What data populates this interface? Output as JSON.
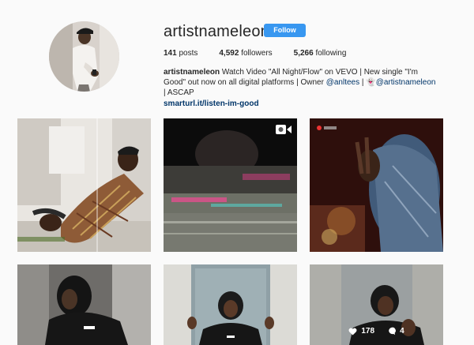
{
  "profile": {
    "username": "artistnameleon",
    "follow_label": "Follow",
    "posts_count": "141",
    "posts_label": "posts",
    "followers_count": "4,592",
    "followers_label": "followers",
    "following_count": "5,266",
    "following_label": "following"
  },
  "bio": {
    "name": "artistnameleon",
    "text_1": "Watch Video \"All Night/Flow\" on VEVO | New single \"I'm Good\" out now on all digital platforms | Owner ",
    "mention_1": "@anltees",
    "text_2": " | ",
    "emoji": "👻",
    "mention_2": "@artistnameleon",
    "text_3": " | ASCAP",
    "link": "smarturl.it/listen-im-good"
  },
  "posts": [
    {
      "id": "post-1"
    },
    {
      "id": "post-2",
      "icon": "video-camera-icon"
    },
    {
      "id": "post-3"
    },
    {
      "id": "post-4"
    },
    {
      "id": "post-5"
    },
    {
      "id": "post-6",
      "likes": "178",
      "comments": "4",
      "icons": [
        "heart-icon",
        "comment-icon"
      ]
    }
  ],
  "colors": {
    "follow_button": "#3897f0",
    "link": "#003569",
    "background": "#fafafa"
  }
}
